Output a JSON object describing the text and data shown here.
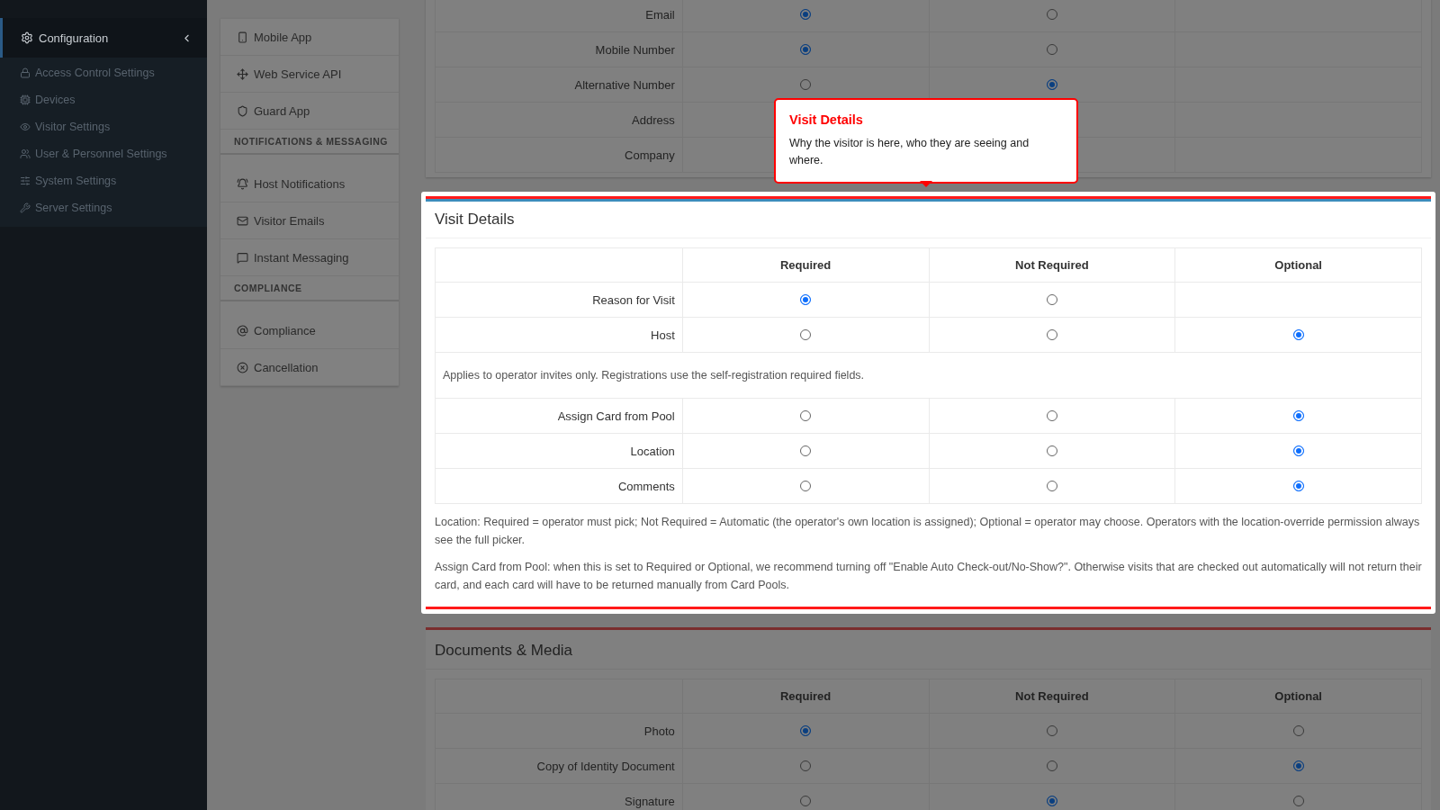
{
  "sidebar": {
    "items": [
      {
        "label": "Configuration",
        "selected": true,
        "expanded": true,
        "children": [
          {
            "label": "Access Control Settings",
            "selected": false
          },
          {
            "label": "Devices",
            "selected": false
          },
          {
            "label": "Visitor Settings",
            "selected": false
          },
          {
            "label": "User & Personnel Settings",
            "selected": false
          },
          {
            "label": "System Settings",
            "selected": false
          },
          {
            "label": "Server Settings",
            "selected": false
          }
        ]
      }
    ]
  },
  "submenu": {
    "sections": [
      {
        "items": [
          {
            "label": "Mobile App"
          },
          {
            "label": "Web Service API"
          },
          {
            "label": "Guard App"
          }
        ]
      },
      {
        "heading": "NOTIFICATIONS & MESSAGING",
        "items": [
          {
            "label": "Host Notifications"
          },
          {
            "label": "Visitor Emails"
          },
          {
            "label": "Instant Messaging"
          }
        ]
      },
      {
        "heading": "COMPLIANCE",
        "items": [
          {
            "label": "Compliance"
          },
          {
            "label": "Cancellation"
          }
        ]
      }
    ]
  },
  "contact_card": {
    "rows": [
      {
        "label": "Email",
        "radios": [
          {
            "selected": true
          },
          {
            "selected": false
          }
        ]
      },
      {
        "label": "Mobile Number",
        "radios": [
          {
            "selected": true
          },
          {
            "selected": false
          }
        ]
      },
      {
        "label": "Alternative Number",
        "radios": [
          {
            "selected": false
          },
          {
            "selected": true
          }
        ]
      },
      {
        "label": "Address"
      },
      {
        "label": "Company"
      }
    ]
  },
  "tour_tooltip": {
    "title": "Visit Details",
    "text": "Why the visitor is here, who they are seeing and where."
  },
  "visit_details": {
    "title": "Visit Details",
    "highlighted": true,
    "columns": [
      "Required",
      "Not Required",
      "Optional"
    ],
    "rows": [
      {
        "kind": "choice",
        "label": "Reason for Visit",
        "radios": [
          {
            "selected": true
          },
          {
            "selected": false
          }
        ]
      },
      {
        "kind": "choice",
        "label": "Host",
        "radios": [
          {
            "selected": false
          },
          {
            "selected": false
          },
          {
            "selected": true
          }
        ]
      },
      {
        "kind": "note",
        "text": "Applies to operator invites only. Registrations use the self-registration required fields."
      },
      {
        "kind": "choice",
        "label": "Assign Card from Pool",
        "radios": [
          {
            "selected": false
          },
          {
            "selected": false
          },
          {
            "selected": true
          }
        ]
      },
      {
        "kind": "choice",
        "label": "Location",
        "radios": [
          {
            "selected": false
          },
          {
            "selected": false
          },
          {
            "selected": true
          }
        ]
      },
      {
        "kind": "choice",
        "label": "Comments",
        "radios": [
          {
            "selected": false
          },
          {
            "selected": false
          },
          {
            "selected": true
          }
        ]
      }
    ],
    "notes": [
      "Location: Required = operator must pick; Not Required = Automatic (the operator's own location is assigned); Optional = operator may choose. Operators with the location-override permission always see the full picker.",
      "Assign Card from Pool: when this is set to Required or Optional, we recommend turning off \"Enable Auto Check-out/No-Show?\". Otherwise visits that are checked out automatically will not return their card, and each card will have to be returned manually from Card Pools."
    ]
  },
  "documents_card": {
    "title": "Documents & Media",
    "highlighted": false,
    "columns": [
      "Required",
      "Not Required",
      "Optional"
    ],
    "rows": [
      {
        "kind": "choice",
        "label": "Photo",
        "radios": [
          {
            "selected": true
          },
          {
            "selected": false
          },
          {
            "selected": false
          }
        ]
      },
      {
        "kind": "choice",
        "label": "Copy of Identity Document",
        "radios": [
          {
            "selected": false
          },
          {
            "selected": false
          },
          {
            "selected": true
          }
        ]
      },
      {
        "kind": "choice",
        "label": "Signature",
        "radios": [
          {
            "selected": false
          },
          {
            "selected": true
          },
          {
            "selected": false
          }
        ]
      }
    ]
  }
}
